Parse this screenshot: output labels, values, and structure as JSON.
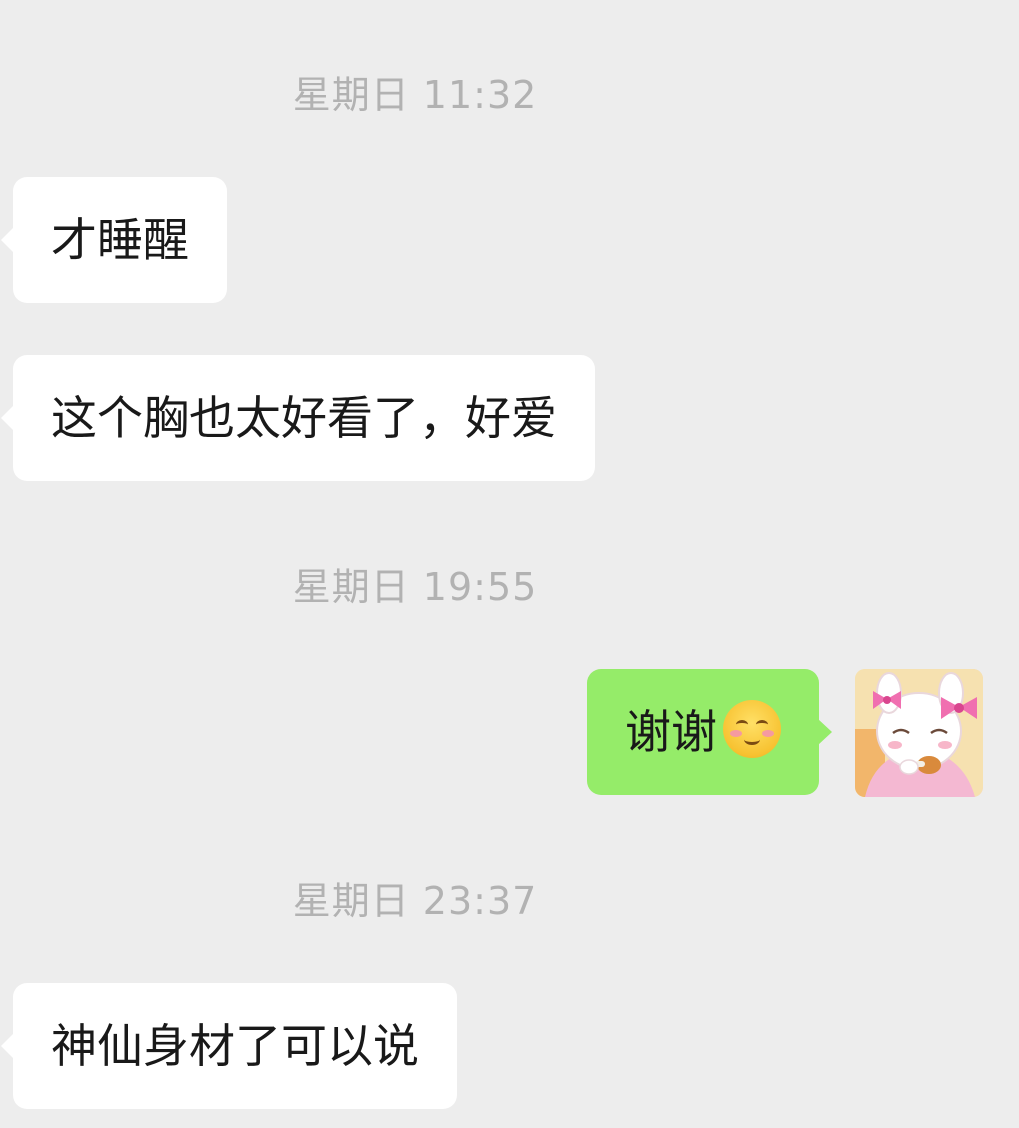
{
  "chat": {
    "messages": [
      {
        "type": "timestamp",
        "text": "星期日 11:32"
      },
      {
        "type": "incoming",
        "text": "才睡醒"
      },
      {
        "type": "incoming",
        "text": "这个胸也太好看了，好爱"
      },
      {
        "type": "timestamp",
        "text": "星期日 19:55"
      },
      {
        "type": "outgoing",
        "text": "谢谢",
        "emoji": "smiling-face-emoji"
      },
      {
        "type": "timestamp",
        "text": "星期日 23:37"
      },
      {
        "type": "incoming",
        "text": "神仙身材了可以说"
      }
    ]
  },
  "colors": {
    "background": "#ededed",
    "incoming_bubble": "#ffffff",
    "outgoing_bubble": "#95ec69",
    "timestamp_text": "#b2b2b2"
  },
  "avatar": {
    "icon": "cartoon-bunny-avatar-icon"
  }
}
